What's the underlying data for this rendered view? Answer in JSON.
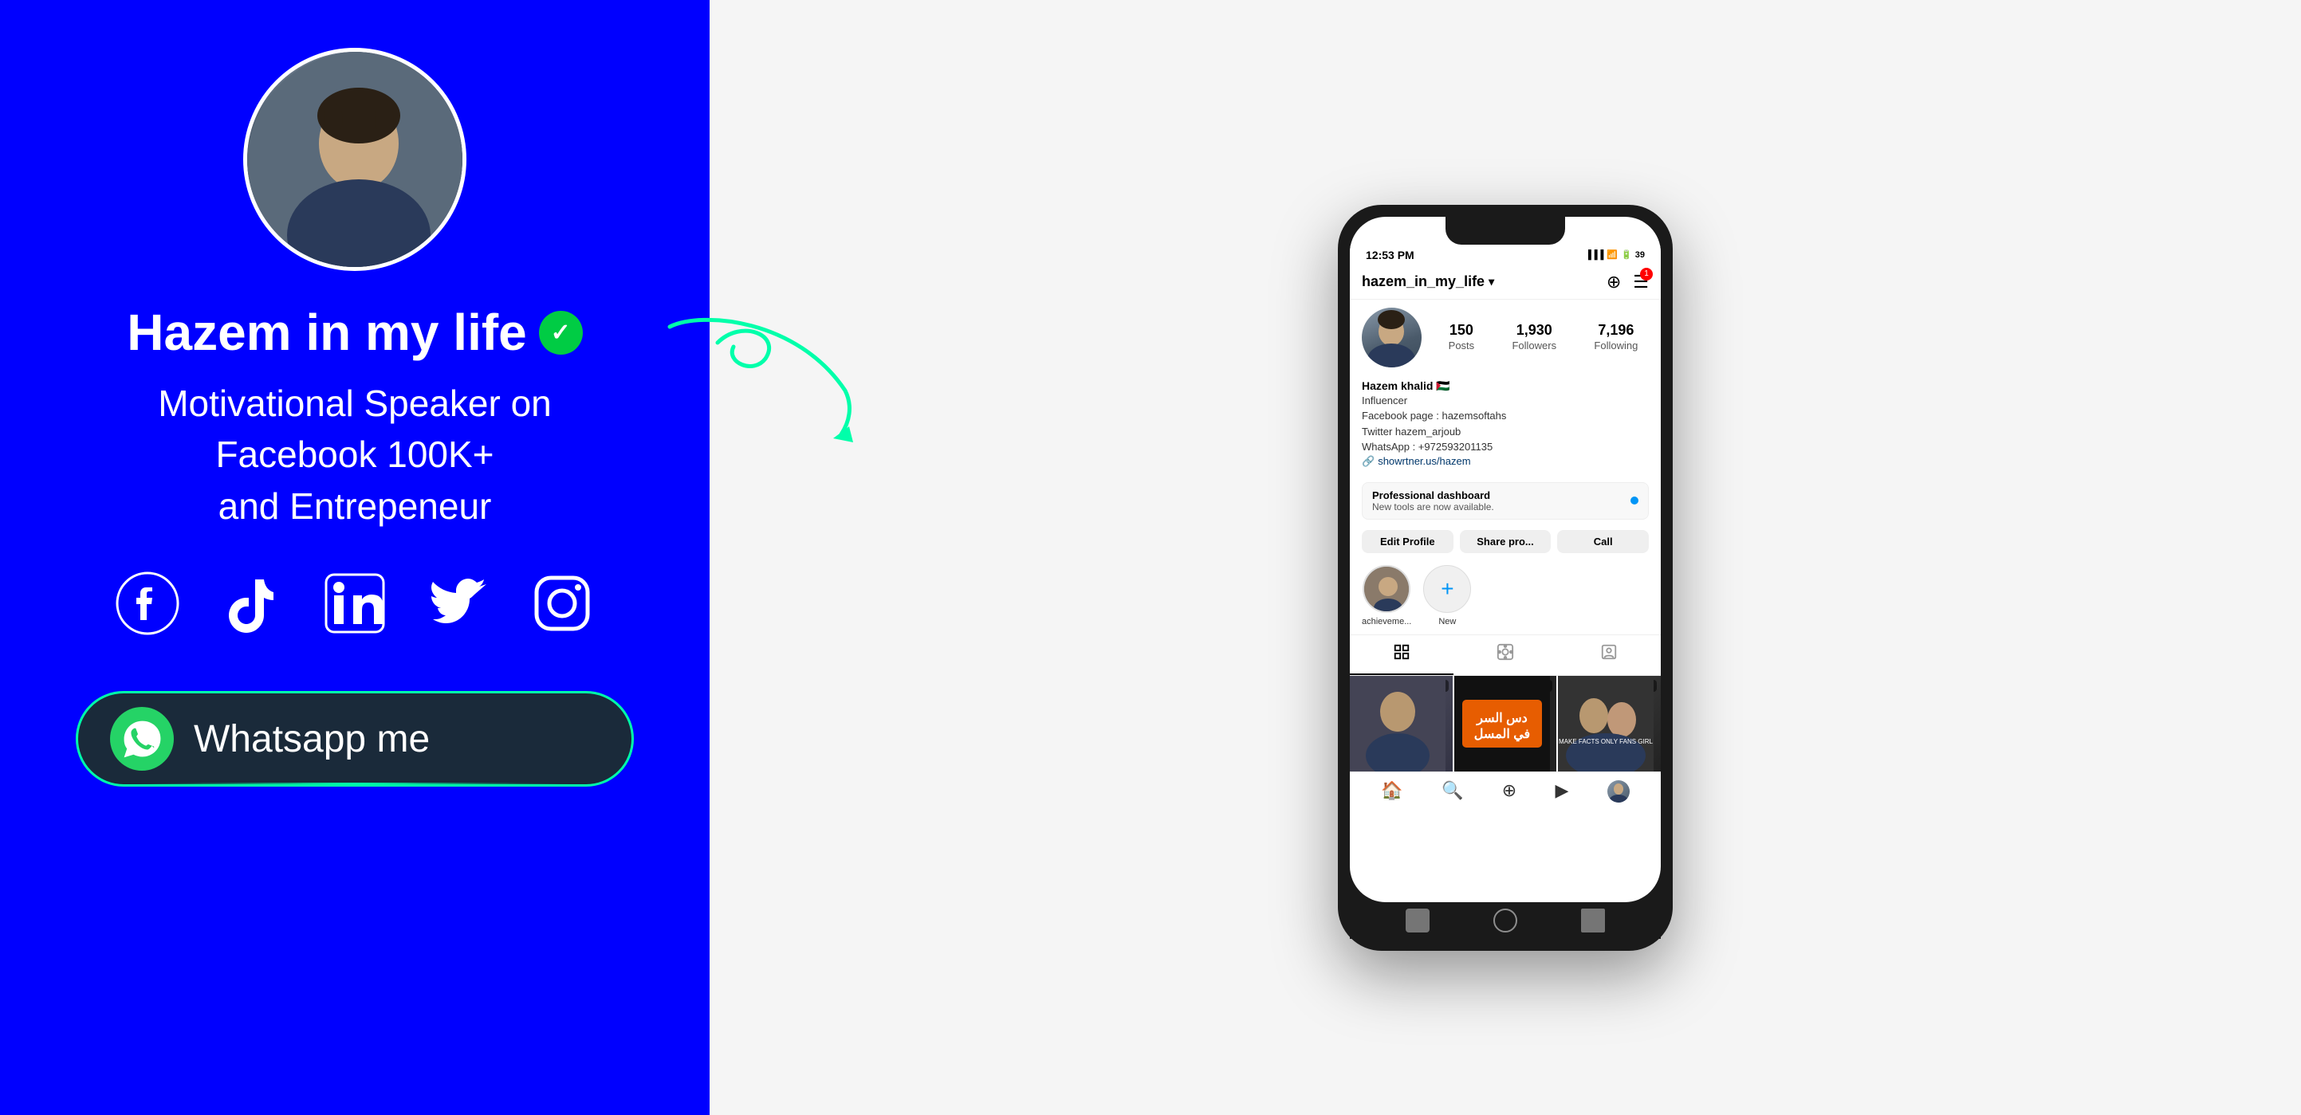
{
  "left": {
    "name": "Hazem in my life",
    "verified": "✓",
    "bio_line1": "Motivational Speaker on Facebook 100K+",
    "bio_line2": "and Entrepeneur",
    "whatsapp_label": "Whatsapp me",
    "social_icons": [
      "facebook",
      "tiktok",
      "linkedin",
      "twitter",
      "instagram"
    ]
  },
  "phone": {
    "status_bar": {
      "time": "12:53 PM",
      "signal": "●●●",
      "wifi": "WiFi",
      "battery": "39"
    },
    "header": {
      "username": "hazem_in_my_life",
      "chevron": "›",
      "add_icon": "+",
      "menu_icon": "≡"
    },
    "stats": {
      "posts_count": "150",
      "posts_label": "Posts",
      "followers_count": "1,930",
      "followers_label": "Followers",
      "following_count": "7,196",
      "following_label": "Following"
    },
    "bio": {
      "name": "Hazem khalid 🇵🇸",
      "line1": "Influencer",
      "line2": "Facebook page : hazemsoftahs",
      "line3": "Twitter hazem_arjoub",
      "line4": "WhatsApp : +972593201135",
      "link": "showrtner.us/hazem"
    },
    "dashboard": {
      "title": "Professional dashboard",
      "subtitle": "New tools are now available."
    },
    "action_buttons": {
      "edit": "Edit Profile",
      "share": "Share pro...",
      "call": "Call"
    },
    "stories": [
      {
        "label": "achieveme...",
        "has_content": true
      },
      {
        "label": "New",
        "is_add": true
      }
    ],
    "tabs": [
      "grid",
      "reels",
      "tagged"
    ],
    "grid_items": [
      {
        "badge": "▶",
        "text": ""
      },
      {
        "badge": "①",
        "text": "دس السر\nفي المسل"
      },
      {
        "badge": "▶",
        "text": ""
      }
    ],
    "bottom_nav": [
      "home",
      "search",
      "add",
      "reels",
      "profile"
    ],
    "phone_nav": [
      "square",
      "circle",
      "back"
    ]
  }
}
